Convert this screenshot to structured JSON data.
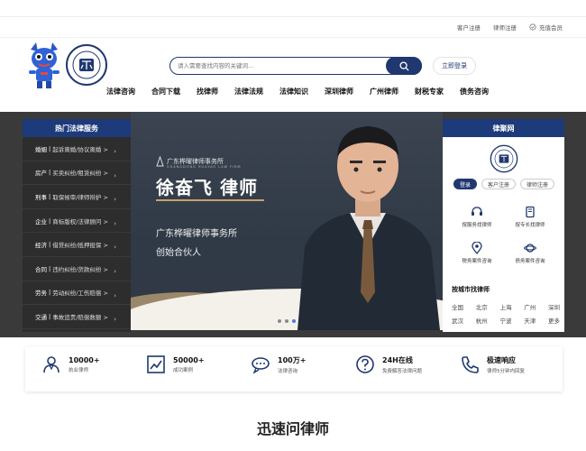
{
  "toplinks": {
    "client_register": "客户注册",
    "lawyer_register": "律师注册",
    "vip": "充值会员"
  },
  "search": {
    "placeholder": "请入需要查找内容的关键词...",
    "login": "立即登录"
  },
  "nav": [
    "法律咨询",
    "合同下载",
    "找律师",
    "法律法规",
    "法律知识",
    "深圳律师",
    "广州律师",
    "财税专家",
    "债务咨询"
  ],
  "sidebar": {
    "title": "热门法律服务",
    "items": [
      {
        "cat": "婚姻",
        "sub": "起诉离婚/协议离婚 >"
      },
      {
        "cat": "房产",
        "sub": "买卖纠纷/租赁纠纷 >"
      },
      {
        "cat": "刑事",
        "sub": "取保候审/律师辩护 >"
      },
      {
        "cat": "企业",
        "sub": "商标版权/法律顾问 >"
      },
      {
        "cat": "经济",
        "sub": "借贷纠纷/抵押担保 >"
      },
      {
        "cat": "合同",
        "sub": "违约纠纷/货款纠纷 >"
      },
      {
        "cat": "劳务",
        "sub": "劳动纠纷/工伤赔偿 >"
      },
      {
        "cat": "交通",
        "sub": "事故追责/赔偿数额 >"
      }
    ]
  },
  "hero": {
    "firm": "广东桦曜律师事务所",
    "firm_en": "GUANGDONG HUAYAO LAW FIRM",
    "name": "徐奋飞 律师",
    "line1": "广东桦曜律师事务所",
    "line2": "创始合伙人"
  },
  "rpanel": {
    "title": "律聚网",
    "tabs": [
      "登录",
      "客户注册",
      "律师注册"
    ],
    "services": [
      {
        "label": "按服务找律师",
        "icon": "headset-icon"
      },
      {
        "label": "按专长找律师",
        "icon": "book-icon"
      },
      {
        "label": "税务案件咨询",
        "icon": "location-icon"
      },
      {
        "label": "债务案件咨询",
        "icon": "planet-icon"
      }
    ],
    "city_title": "按城市找律师",
    "cities_row1": [
      "全国",
      "北京",
      "上海",
      "广州",
      "深圳"
    ],
    "cities_row2": [
      "武汉",
      "杭州",
      "宁波",
      "天津",
      "更多"
    ]
  },
  "stats": [
    {
      "num": "10000+",
      "lbl": "执业律师",
      "icon": "lawyer-icon"
    },
    {
      "num": "50000+",
      "lbl": "成功案例",
      "icon": "chart-icon"
    },
    {
      "num": "100万+",
      "lbl": "法律咨询",
      "icon": "consult-icon"
    },
    {
      "num": "24H在线",
      "lbl": "免费解答法律问题",
      "icon": "question-icon"
    },
    {
      "num": "极速响应",
      "lbl": "律师5分钟内回复",
      "icon": "phone-icon"
    }
  ],
  "section_title": "迅速问律师",
  "colors": {
    "brand": "#20386f",
    "panel_header": "#1d3a7a",
    "gold": "#c9a06b"
  }
}
